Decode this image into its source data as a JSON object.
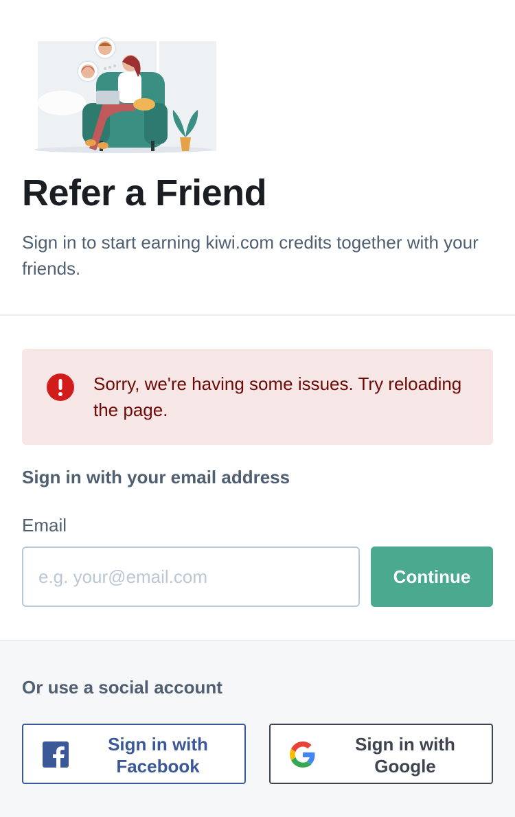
{
  "header": {
    "title": "Refer a Friend",
    "subtitle": "Sign in to start earning kiwi.com credits together with your friends."
  },
  "alert": {
    "message": "Sorry, we're having some issues. Try reloading the page.",
    "icon": "alert-circle-icon",
    "color": "#d21c1c"
  },
  "email_form": {
    "heading": "Sign in with your email address",
    "label": "Email",
    "placeholder": "e.g. your@email.com",
    "value": "",
    "button_label": "Continue"
  },
  "social": {
    "heading": "Or use a social account",
    "facebook_label": "Sign in with Facebook",
    "google_label": "Sign in with Google"
  },
  "colors": {
    "accent": "#4aa98f",
    "facebook": "#3b5998",
    "alert_bg": "#f6e6e6"
  }
}
